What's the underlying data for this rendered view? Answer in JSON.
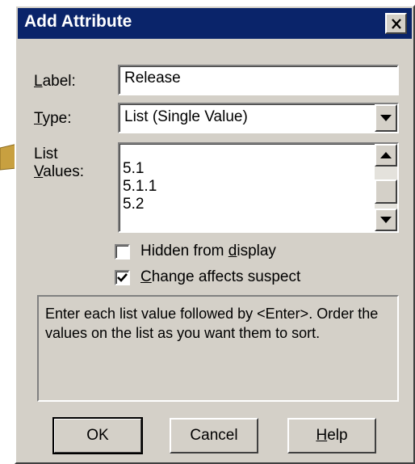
{
  "dialog": {
    "title": "Add Attribute",
    "close_glyph": "✕"
  },
  "form": {
    "label_caption_prefix": "",
    "label_caption_mnemonic": "L",
    "label_caption_rest": "abel:",
    "label_value": "Release",
    "type_caption_mnemonic": "T",
    "type_caption_rest": "ype:",
    "type_value": "List (Single Value)",
    "list_caption_line1": "List",
    "list_caption_mnemonic": "V",
    "list_caption_rest": "alues:",
    "list_values": [
      "5.1",
      "5.1.1",
      "5.2"
    ]
  },
  "checkboxes": {
    "hidden": {
      "label_prefix": "Hidden from ",
      "label_mnemonic": "d",
      "label_rest": "isplay",
      "checked": false
    },
    "suspect": {
      "label_prefix": "",
      "label_mnemonic": "C",
      "label_rest": "hange affects suspect",
      "checked": true
    }
  },
  "info": {
    "text": "Enter each list value followed by <Enter>. Order the values on the list as you want them to sort."
  },
  "buttons": {
    "ok": "OK",
    "cancel": "Cancel",
    "help_mnemonic": "H",
    "help_rest": "elp"
  },
  "colors": {
    "title_bar": "#0a246a",
    "dialog_face": "#d4d0c8",
    "callout_arrow": "#c8a040"
  }
}
